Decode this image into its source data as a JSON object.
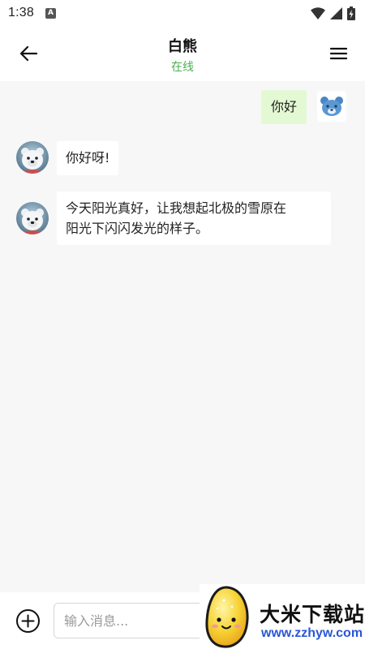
{
  "status_bar": {
    "time": "1:38",
    "app_icon_letter": "A"
  },
  "header": {
    "title": "白熊",
    "status": "在线"
  },
  "messages": [
    {
      "sender": "me",
      "text": "你好"
    },
    {
      "sender": "bear",
      "text": "你好呀!"
    },
    {
      "sender": "bear",
      "text_line1": "今天阳光真好，让我想起北极的雪原在",
      "text_line2": "阳光下闪闪发光的样子。"
    }
  ],
  "input": {
    "placeholder": "输入消息..."
  },
  "watermark": {
    "brand": "大米下载站",
    "url": "www.zzhyw.com"
  },
  "colors": {
    "online_status": "#4caf50",
    "outgoing_bubble": "#e3f9d3",
    "incoming_bubble": "#ffffff",
    "chat_background": "#f7f7f7",
    "watermark_url": "#2a56d6"
  }
}
